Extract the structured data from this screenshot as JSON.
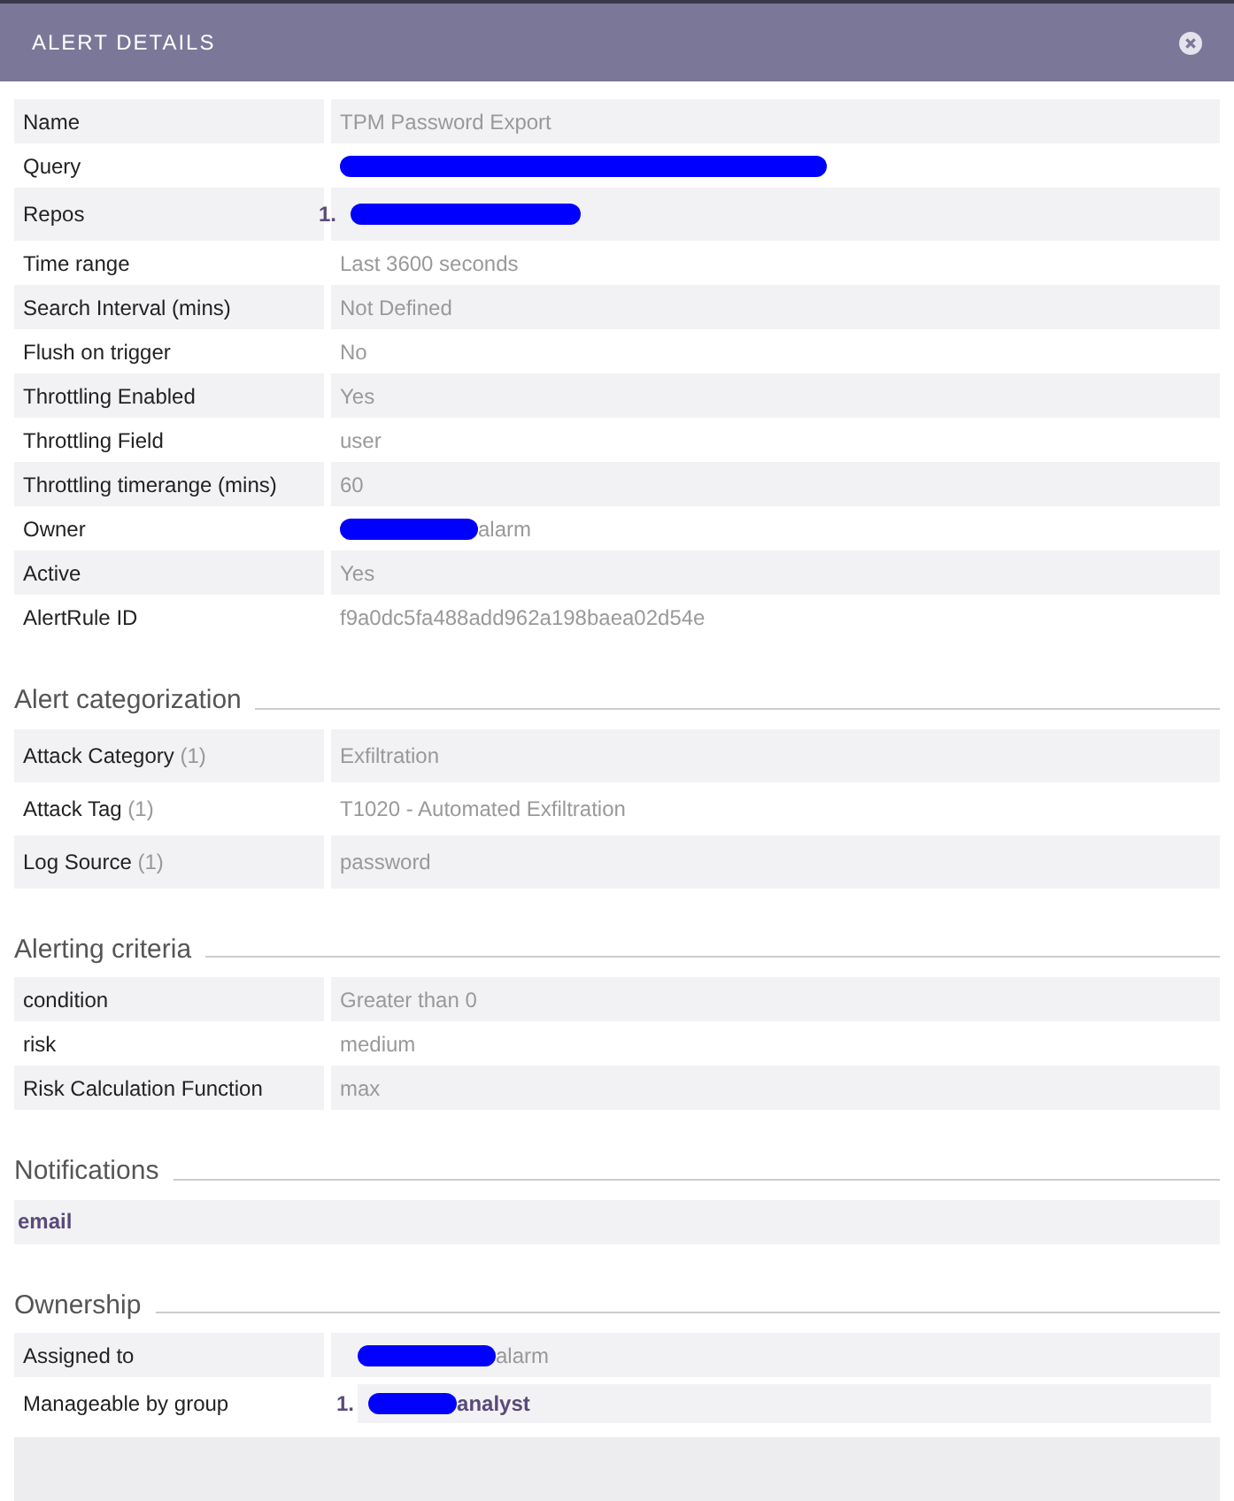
{
  "window": {
    "title": "ALERT DETAILS"
  },
  "details": [
    {
      "label": "Name",
      "value": "TPM Password Export",
      "redacted": false
    },
    {
      "label": "Query",
      "redacted": true
    },
    {
      "label": "Repos",
      "number": "1.",
      "redacted": true
    },
    {
      "label": "Time range",
      "value": "Last 3600 seconds",
      "redacted": false
    },
    {
      "label": "Search Interval (mins)",
      "value": "Not Defined",
      "redacted": false
    },
    {
      "label": "Flush on trigger",
      "value": "No",
      "redacted": false
    },
    {
      "label": "Throttling Enabled",
      "value": "Yes",
      "redacted": false
    },
    {
      "label": "Throttling Field",
      "value": "user",
      "redacted": false
    },
    {
      "label": "Throttling timerange (mins)",
      "value": "60",
      "redacted": false
    },
    {
      "label": "Owner",
      "value": "alarm",
      "redacted": true
    },
    {
      "label": "Active",
      "value": "Yes",
      "redacted": false
    },
    {
      "label": "AlertRule ID",
      "value": "f9a0dc5fa488add962a198baea02d54e",
      "redacted": false
    }
  ],
  "categorization": {
    "title": "Alert categorization",
    "rows": [
      {
        "label": "Attack Category",
        "count": "(1)",
        "value": "Exfiltration"
      },
      {
        "label": "Attack Tag",
        "count": "(1)",
        "value": "T1020 - Automated Exfiltration"
      },
      {
        "label": "Log Source",
        "count": "(1)",
        "value": "password"
      }
    ]
  },
  "criteria": {
    "title": "Alerting criteria",
    "rows": [
      {
        "label": "condition",
        "value": "Greater than 0"
      },
      {
        "label": "risk",
        "value": "medium"
      },
      {
        "label": "Risk Calculation Function",
        "value": "max"
      }
    ]
  },
  "notifications": {
    "title": "Notifications",
    "items": [
      "email"
    ]
  },
  "ownership": {
    "title": "Ownership",
    "rows": [
      {
        "label": "Assigned to",
        "value": "alarm",
        "redacted": true
      },
      {
        "label": "Manageable by group",
        "number": "1.",
        "value": "analyst",
        "redacted": true
      }
    ]
  }
}
